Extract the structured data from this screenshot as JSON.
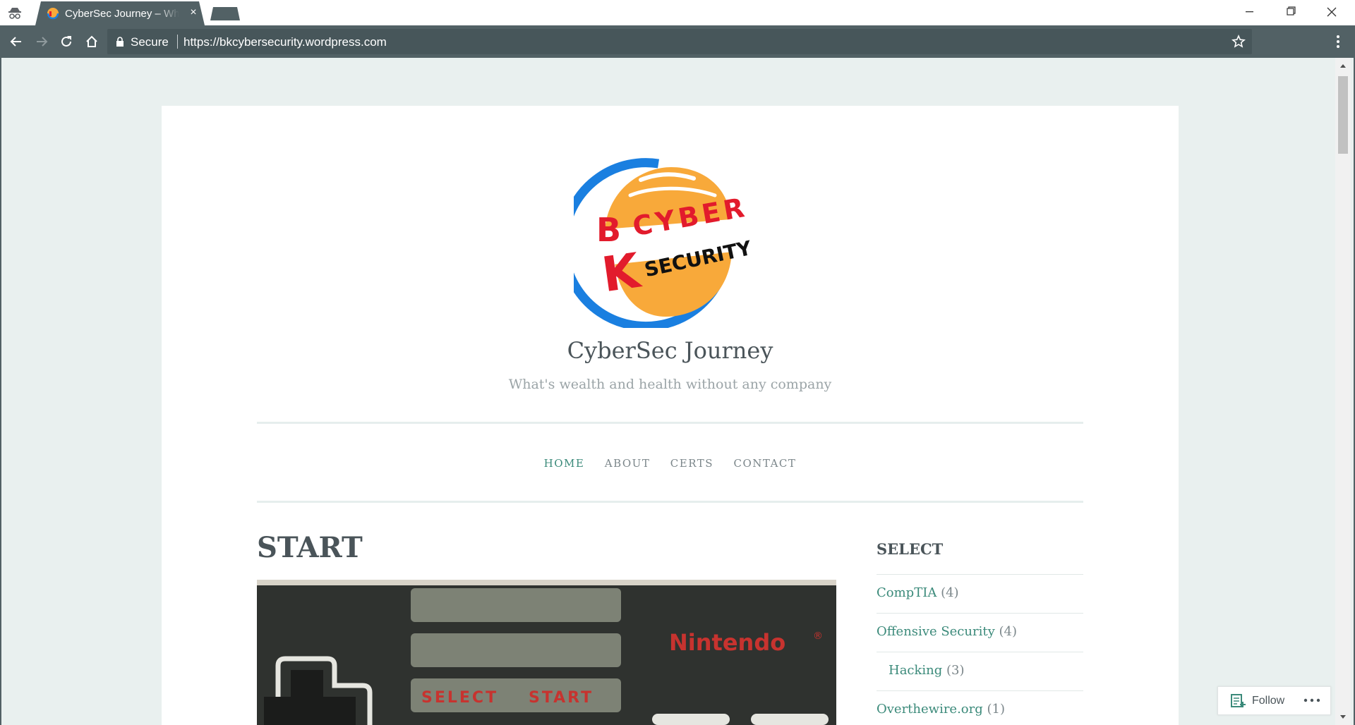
{
  "browser": {
    "tab_title": "CyberSec Journey – What's wealth and health without any company",
    "tab_close": "×",
    "security_label": "Secure",
    "url": "https://bkcybersecurity.wordpress.com"
  },
  "site": {
    "logo_text": {
      "b": "B",
      "k": "K",
      "cyber": "CYBER",
      "security": "SECURITY"
    },
    "title": "CyberSec Journey",
    "tagline": "What's wealth and health without any company"
  },
  "nav": {
    "items": [
      {
        "label": "HOME",
        "active": true
      },
      {
        "label": "ABOUT"
      },
      {
        "label": "CERTS"
      },
      {
        "label": "CONTACT"
      }
    ]
  },
  "post": {
    "title": "START",
    "image_text": {
      "brand": "Nintendo",
      "registered": "®",
      "select": "SELECT",
      "start": "START"
    }
  },
  "sidebar": {
    "widget_title": "SELECT",
    "categories": [
      {
        "name": "CompTIA",
        "count": "(4)"
      },
      {
        "name": "Offensive Security",
        "count": "(4)"
      },
      {
        "name": "Hacking",
        "count": "(3)",
        "child": true
      },
      {
        "name": "Overthewire.org",
        "count": "(1)"
      }
    ]
  },
  "follow": {
    "label": "Follow"
  },
  "colors": {
    "chrome": "#526165",
    "page_bg": "#e9f0ef",
    "accent": "#3b8a7a",
    "logo_blue": "#1a7fe0",
    "logo_orange": "#f8a93a",
    "logo_red": "#e21b2c"
  },
  "icons": [
    "incognito-icon",
    "favicon-icon",
    "close-icon",
    "minimize-icon",
    "maximize-icon",
    "back-icon",
    "forward-icon",
    "reload-icon",
    "home-icon",
    "lock-icon",
    "star-icon",
    "menu-icon",
    "follow-icon",
    "more-icon"
  ]
}
